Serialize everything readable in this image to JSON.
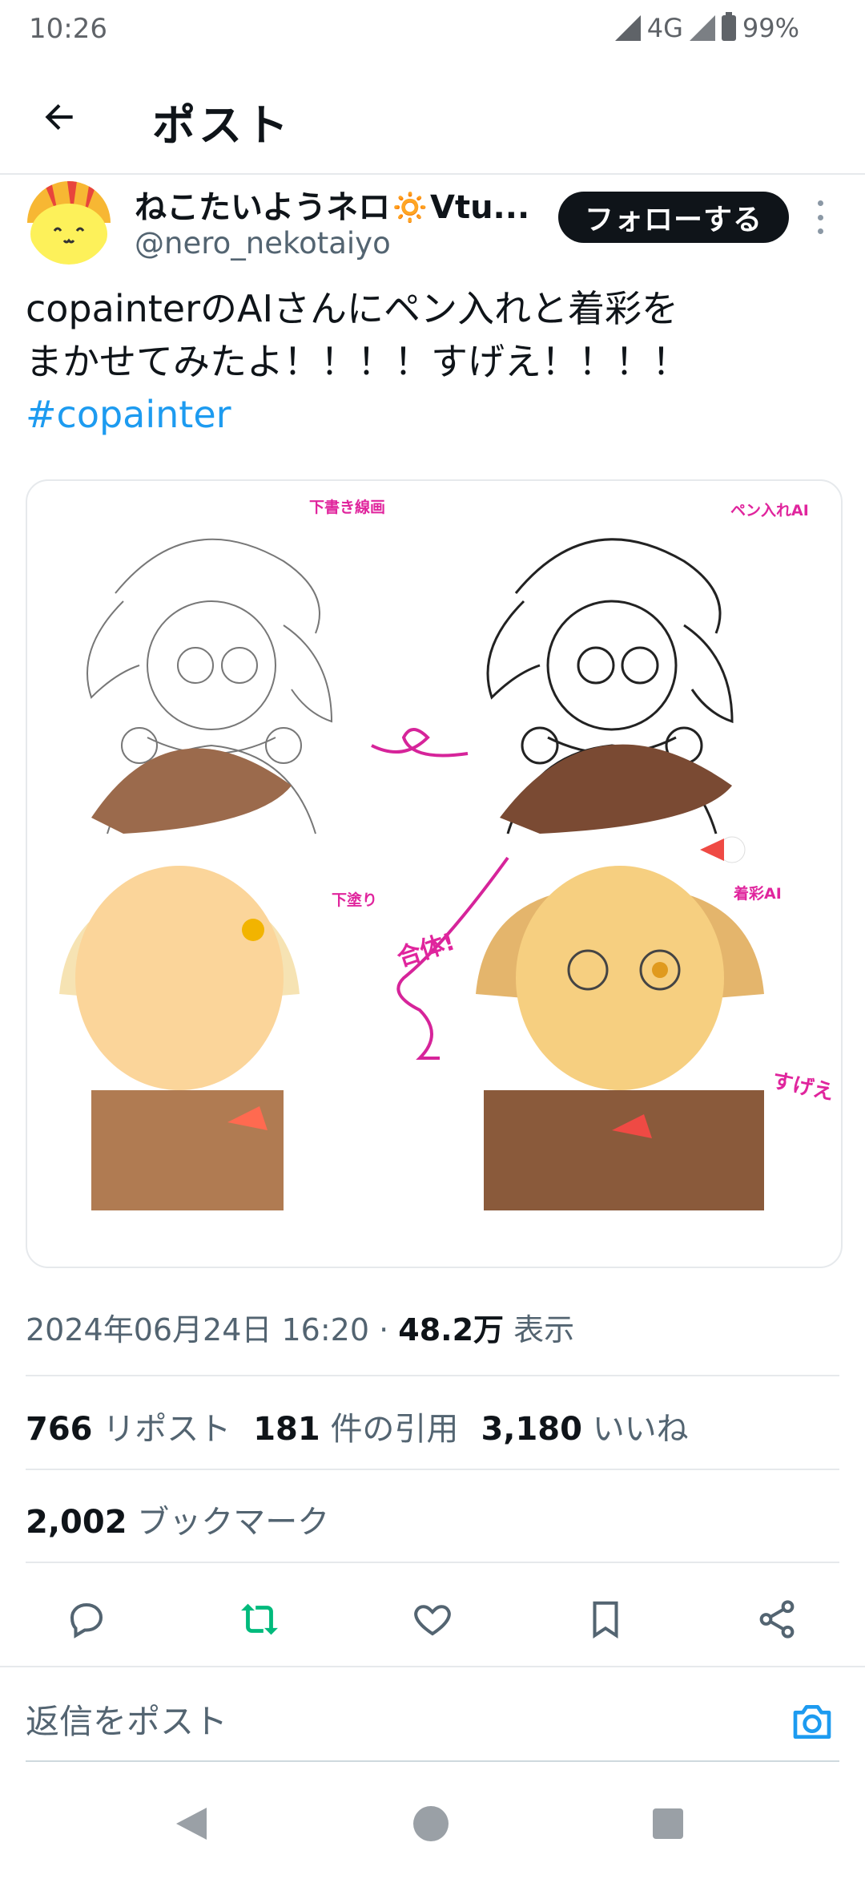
{
  "status_bar": {
    "time": "10:26",
    "network": "4G",
    "battery": "99%"
  },
  "header": {
    "title": "ポスト",
    "back_icon": "arrow-left-icon"
  },
  "author": {
    "display_name": "ねこたいようネロ🔅Vtu...",
    "handle": "@nero_nekotaiyo",
    "follow_label": "フォローする"
  },
  "post": {
    "text_line1": "copainterのAIさんにペン入れと着彩を",
    "text_line2": "まかせてみたよ！！！！すげえ！！！！",
    "hashtag": "#copainter"
  },
  "media": {
    "label_sketch": "下書き線画",
    "label_inking": "ペン入れAI",
    "label_flats": "下塗り",
    "label_color": "着彩AI",
    "note_merge": "合体!",
    "note_wow": "すげえ"
  },
  "meta": {
    "timestamp": "2024年06月24日 16:20",
    "separator": "·",
    "views_count": "48.2万",
    "views_label": "表示"
  },
  "stats": {
    "reposts_count": "766",
    "reposts_label": "リポスト",
    "quotes_count": "181",
    "quotes_label": "件の引用",
    "likes_count": "3,180",
    "likes_label": "いいね",
    "bookmarks_count": "2,002",
    "bookmarks_label": "ブックマーク"
  },
  "reply": {
    "placeholder": "返信をポスト"
  },
  "colors": {
    "accent": "#1d9bf0",
    "repost_green": "#00ba7c",
    "text": "#0f1419",
    "muted": "#536471",
    "label_magenta": "#e0259d"
  }
}
